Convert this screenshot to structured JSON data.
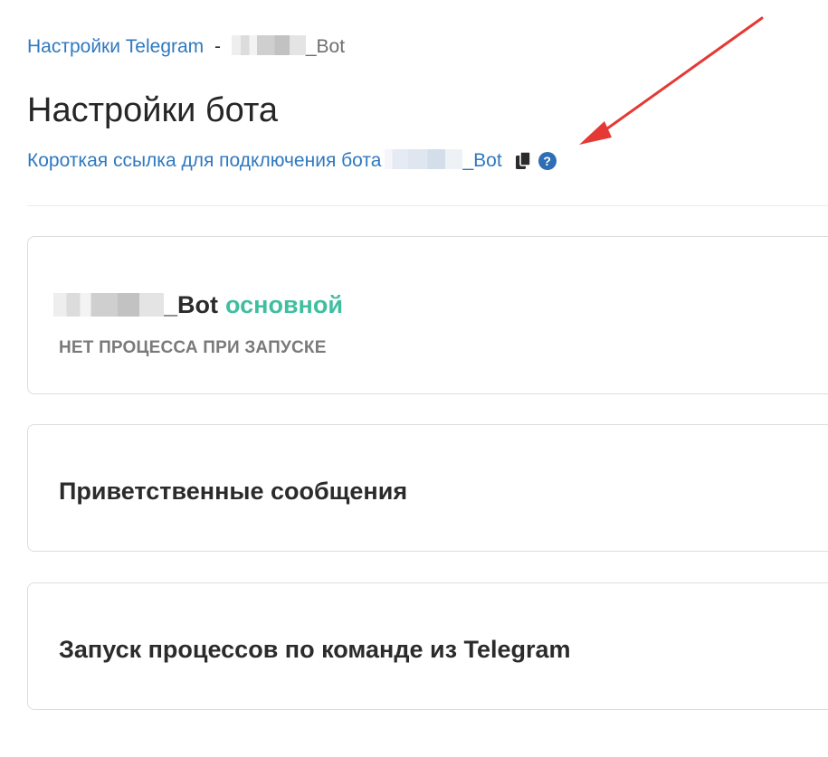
{
  "breadcrumb": {
    "link_label": "Настройки Telegram",
    "separator": "-",
    "bot_suffix": "_Bot"
  },
  "page": {
    "title": "Настройки бота"
  },
  "short_link": {
    "label": "Короткая ссылка для подключения бота",
    "bot_suffix": "_Bot",
    "copy_icon": "copy-icon",
    "help_icon": "help-icon",
    "help_glyph": "?"
  },
  "bot_card": {
    "bot_suffix": "_Bot",
    "badge": "основной",
    "status": "НЕТ ПРОЦЕССА ПРИ ЗАПУСКЕ"
  },
  "sections": {
    "welcome_title": "Приветственные сообщения",
    "launch_title": "Запуск процессов по команде из Telegram"
  },
  "colors": {
    "link": "#2f79c0",
    "badge_green": "#3fbfa0",
    "status_gray": "#7a7a7a",
    "annotation_red": "#e53935",
    "help_blue": "#2f6eb5"
  }
}
